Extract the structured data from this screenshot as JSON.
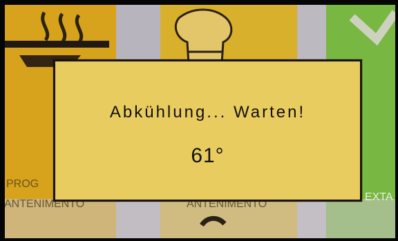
{
  "background": {
    "icons": [
      "steam-pan-icon",
      "chef-hat-icon",
      "checkmark-icon"
    ],
    "captions": [
      "PROG",
      "ANTENIMENTO",
      "ANTENIMENTO",
      "EXTA"
    ]
  },
  "dialog": {
    "message": "Abkühlung... Warten!",
    "temperature": "61°",
    "background_color": "#e9cc60"
  }
}
